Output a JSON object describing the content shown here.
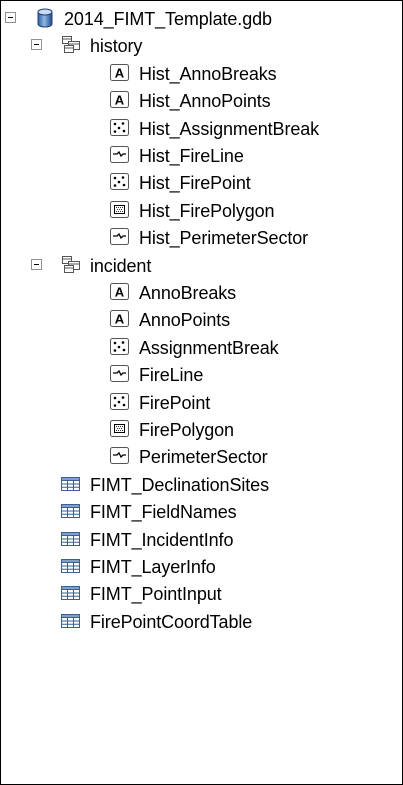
{
  "tree": {
    "root": {
      "label": "2014_FIMT_Template.gdb",
      "icon": "geodatabase-icon",
      "expanded": true,
      "children": [
        {
          "label": "history",
          "icon": "feature-dataset-icon",
          "expanded": true,
          "children": [
            {
              "label": "Hist_AnnoBreaks",
              "icon": "annotation-class-icon"
            },
            {
              "label": "Hist_AnnoPoints",
              "icon": "annotation-class-icon"
            },
            {
              "label": "Hist_AssignmentBreak",
              "icon": "point-feature-class-icon"
            },
            {
              "label": "Hist_FireLine",
              "icon": "line-feature-class-icon"
            },
            {
              "label": "Hist_FirePoint",
              "icon": "point-feature-class-icon"
            },
            {
              "label": "Hist_FirePolygon",
              "icon": "polygon-feature-class-icon"
            },
            {
              "label": "Hist_PerimeterSector",
              "icon": "line-feature-class-icon"
            }
          ]
        },
        {
          "label": "incident",
          "icon": "feature-dataset-icon",
          "expanded": true,
          "children": [
            {
              "label": "AnnoBreaks",
              "icon": "annotation-class-icon"
            },
            {
              "label": "AnnoPoints",
              "icon": "annotation-class-icon"
            },
            {
              "label": "AssignmentBreak",
              "icon": "point-feature-class-icon"
            },
            {
              "label": "FireLine",
              "icon": "line-feature-class-icon"
            },
            {
              "label": "FirePoint",
              "icon": "point-feature-class-icon"
            },
            {
              "label": "FirePolygon",
              "icon": "polygon-feature-class-icon"
            },
            {
              "label": "PerimeterSector",
              "icon": "line-feature-class-icon"
            }
          ]
        },
        {
          "label": "FIMT_DeclinationSites",
          "icon": "table-icon"
        },
        {
          "label": "FIMT_FieldNames",
          "icon": "table-icon"
        },
        {
          "label": "FIMT_IncidentInfo",
          "icon": "table-icon"
        },
        {
          "label": "FIMT_LayerInfo",
          "icon": "table-icon"
        },
        {
          "label": "FIMT_PointInput",
          "icon": "table-icon"
        },
        {
          "label": "FirePointCoordTable",
          "icon": "table-icon"
        }
      ]
    }
  }
}
